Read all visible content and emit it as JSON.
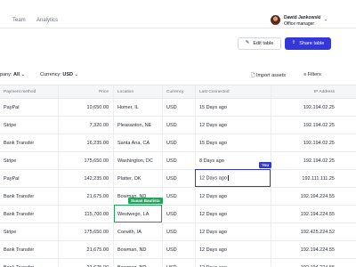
{
  "nav": {
    "tabs": [
      "Team",
      "Analytics"
    ],
    "user": {
      "name": "Dawid Jankowski",
      "role": "Office manager"
    }
  },
  "toolbar": {
    "edit_label": "Edit table",
    "share_label": "Share table"
  },
  "filters": {
    "company_label": "pany:",
    "company_value": "All",
    "currency_label": "Currency:",
    "currency_value": "USD",
    "import_label": "Import assets",
    "filters_label": "Filters"
  },
  "table": {
    "columns": [
      "Payment method",
      "Price",
      "Location",
      "Currency",
      "Last Connected",
      "IP Address"
    ],
    "rows": [
      [
        "PayPal",
        "10,650.00",
        "Homer, IL",
        "USD",
        "15 Days ago",
        "192.194.02.25"
      ],
      [
        "Stripe",
        "7,320.00",
        "Pleasanton, NE",
        "USD",
        "12 Days ago",
        "192.194.02.25"
      ],
      [
        "Bank Transfer",
        "16,235.00",
        "Santa Ana, CA",
        "USD",
        "15 Days ago",
        "192.194.02.25"
      ],
      [
        "Stripe",
        "175,650.00",
        "Washington, DC",
        "USD",
        "8 Days ago",
        "192.194.02.25"
      ],
      [
        "PayPal",
        "142,235.00",
        "Platter, OK",
        "USD",
        "12 Days ago",
        "192.111.111.25"
      ],
      [
        "Bank Transfer",
        "21,675.00",
        "Bowman, ND",
        "USD",
        "12 Days ago",
        "192.194.224.55"
      ],
      [
        "Bank Transfer",
        "115,700.00",
        "Westwego, LA",
        "USD",
        "12 Days ago",
        "192.194.224.55"
      ],
      [
        "Stripe",
        "175,650.00",
        "Corwith, IA",
        "USD",
        "12 Days ago",
        "192.425.224.52"
      ],
      [
        "Bank Transfer",
        "21,675.00",
        "Bowman, ND",
        "USD",
        "12 Days ago",
        "192.194.224.55"
      ],
      [
        "Bank Transfer",
        "21,675.00",
        "Bowman, ND",
        "USD",
        "12 Days ago",
        "192.194.224.55"
      ]
    ]
  },
  "collaborators": {
    "you_label": "You",
    "susan_label": "Susan Bautista"
  },
  "colors": {
    "accent": "#3438d8",
    "collab_green": "#22a559"
  }
}
